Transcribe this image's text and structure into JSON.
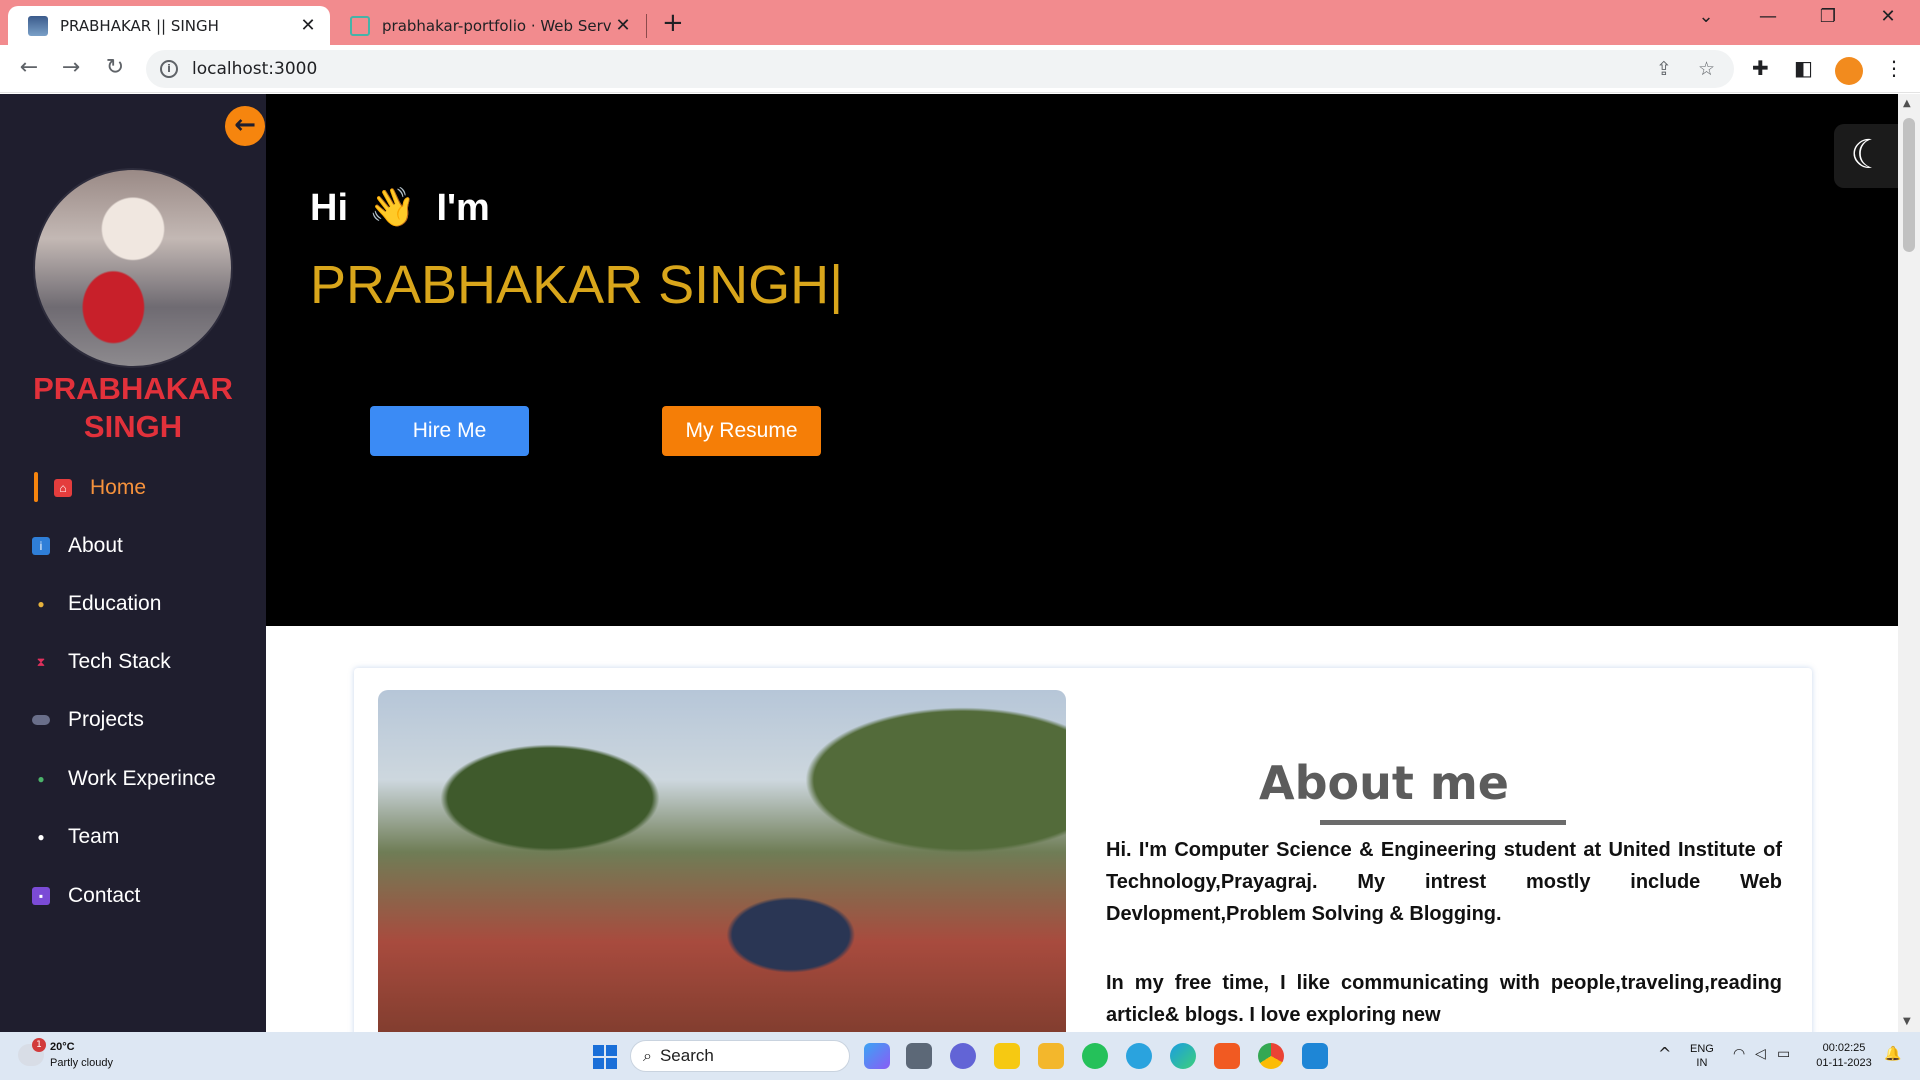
{
  "browser": {
    "tabs": [
      {
        "title": "PRABHAKAR || SINGH",
        "active": true
      },
      {
        "title": "prabhakar-portfolio · Web Service",
        "active": false
      }
    ],
    "close_glyph": "✕",
    "newtab_glyph": "+",
    "url": "localhost:3000",
    "window_controls": {
      "minimize": "—",
      "maximize": "❐",
      "close": "✕",
      "tabsearch": "⌄"
    }
  },
  "sidebar": {
    "name": "PRABHAKAR SINGH",
    "collapse_glyph": "←",
    "items": [
      {
        "label": "Home",
        "icon": "home-icon",
        "active": true
      },
      {
        "label": "About",
        "icon": "info-icon",
        "active": false
      },
      {
        "label": "Education",
        "icon": "student-icon",
        "active": false
      },
      {
        "label": "Tech Stack",
        "icon": "hourglass-icon",
        "active": false
      },
      {
        "label": "Projects",
        "icon": "controller-icon",
        "active": false
      },
      {
        "label": "Work Experince",
        "icon": "worker-icon",
        "active": false
      },
      {
        "label": "Team",
        "icon": "people-icon",
        "active": false
      },
      {
        "label": "Contact",
        "icon": "contact-card-icon",
        "active": false
      }
    ],
    "accent_color": "#f6850e",
    "name_color": "#e2313b"
  },
  "hero": {
    "greeting_prefix": "Hi",
    "wave": "👋",
    "greeting_suffix": "I'm",
    "name": "PRABHAKAR SINGH",
    "cursor": "|",
    "hire_label": "Hire Me",
    "resume_label": "My Resume",
    "name_color": "#d9a61b"
  },
  "theme_toggle": {
    "glyph": "☾"
  },
  "about": {
    "heading": "About me",
    "paragraph1": "Hi. I'm Computer Science & Engineering student at United Institute of Technology,Prayagraj. My intrest mostly include Web Devlopment,Problem Solving & Blogging.",
    "paragraph2": "In my free time, I like communicating with people,traveling,reading article& blogs. I love exploring new"
  },
  "taskbar": {
    "weather_temp": "20°C",
    "weather_desc": "Partly cloudy",
    "weather_badge": "1",
    "search_label": "Search",
    "search_glyph": "⌕",
    "lang_line1": "ENG",
    "lang_line2": "IN",
    "time": "00:02:25",
    "date": "01-11-2023",
    "chevron": "^"
  }
}
